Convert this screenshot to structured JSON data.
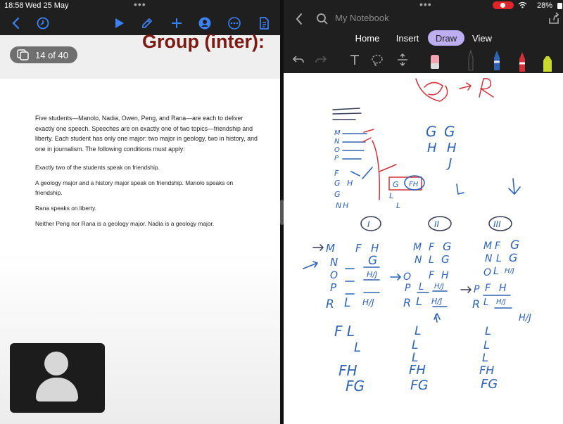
{
  "status": {
    "time": "18:58",
    "date": "Wed 25 May",
    "battery": "28%"
  },
  "reader": {
    "page_indicator": "14 of 40",
    "heading": "Group (inter):",
    "passage": {
      "intro": "Five students—Manolo, Nadia, Owen, Peng, and Rana—are each to deliver exactly one speech. Speeches are on exactly one of two topics—friendship and liberty. Each student has only one major: two major in geology, two in history, and one in journalism. The following conditions must apply:",
      "conditions": [
        "Exactly two of the students speak on friendship.",
        "A geology major and a history major speak on friendship. Manolo speaks on friendship.",
        "Rana speaks on liberty.",
        "Neither Peng nor Rana is a geology major. Nadia is a geology major."
      ]
    }
  },
  "notebook": {
    "title": "My Notebook",
    "tabs": [
      "Home",
      "Insert",
      "Draw",
      "View"
    ],
    "active_tab": "Draw",
    "pen_colors": [
      "#2f63b4",
      "#d1323c",
      "#c9d930"
    ],
    "ink": {
      "students": [
        "M",
        "N",
        "O",
        "P",
        "R"
      ],
      "columns": [
        "F",
        "H"
      ],
      "case_labels": [
        "I",
        "II",
        "III"
      ],
      "top_letters": [
        "G",
        "G",
        "H",
        "H",
        "J"
      ],
      "case1": [
        "G",
        "H/J",
        "L",
        "H/J"
      ],
      "case2": [
        "F",
        "G",
        "L",
        "G",
        "F",
        "H",
        "L",
        "H/J",
        "L",
        "H/J"
      ],
      "case3": [
        "F",
        "G",
        "L",
        "G",
        "L",
        "H/J",
        "F",
        "H",
        "L",
        "H/J"
      ],
      "hj": "H/J",
      "l": "L",
      "bottom_f_l": "F  L",
      "fh": "FH",
      "fg": "FG"
    }
  }
}
